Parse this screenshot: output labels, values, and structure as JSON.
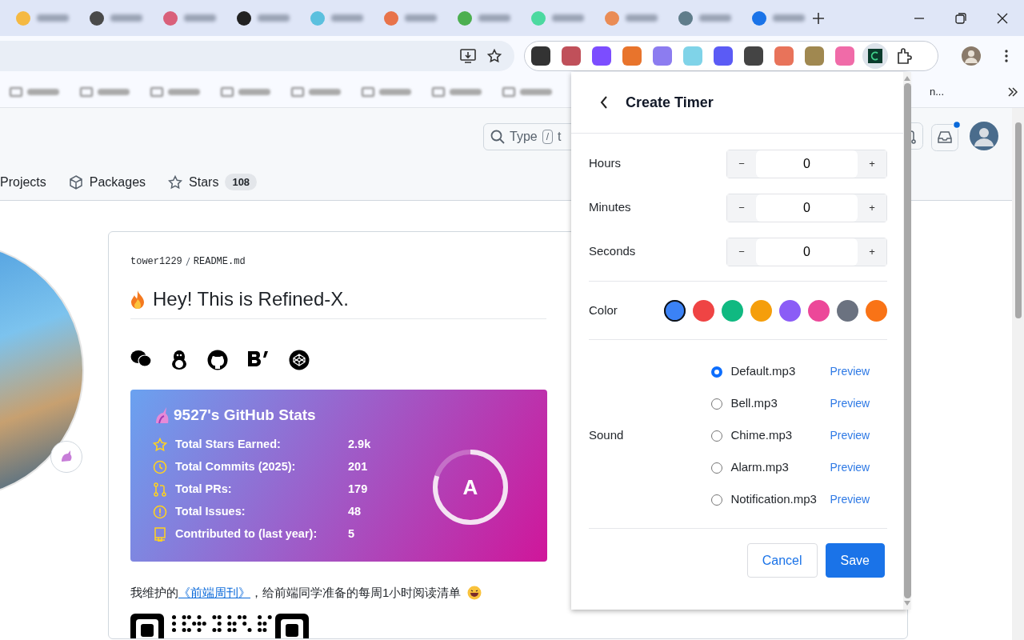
{
  "browser": {
    "tabs": [
      {
        "color": "#f5b942"
      },
      {
        "color": "#4a4a4a"
      },
      {
        "color": "#d9607a"
      },
      {
        "color": "#222222"
      },
      {
        "color": "#5bc0de"
      },
      {
        "color": "#e8734a"
      },
      {
        "color": "#4caf50"
      },
      {
        "color": "#4cd9a0"
      },
      {
        "color": "#ea8c55"
      },
      {
        "color": "#607d8b"
      },
      {
        "color": "#1a73e8"
      }
    ],
    "extensions": [
      {
        "color": "#333333"
      },
      {
        "color": "#c0505a"
      },
      {
        "color": "#7c4dff"
      },
      {
        "color": "#e8742c"
      },
      {
        "color": "#8c7cf0"
      },
      {
        "color": "#7fd3e8"
      },
      {
        "color": "#5b5bf5"
      },
      {
        "color": "#444444"
      },
      {
        "color": "#e8735a"
      },
      {
        "color": "#a08850"
      },
      {
        "color": "#f06ba8"
      }
    ],
    "bookmark_overflow": "n..."
  },
  "github": {
    "search": {
      "start": "Type",
      "shortcut": "/",
      "end": "t"
    },
    "nav": [
      {
        "kind": "projects",
        "label": "Projects"
      },
      {
        "kind": "packages",
        "label": "Packages"
      },
      {
        "kind": "stars",
        "label": "Stars",
        "count": "108"
      }
    ],
    "readme": {
      "owner": "tower1229",
      "file": "README.md",
      "heading": "Hey! This is Refined-X.",
      "stats": {
        "title": "9527's GitHub Stats",
        "grade": "A",
        "level": 0.8,
        "rows": [
          {
            "kind": "star",
            "label": "Total Stars Earned:",
            "value": "2.9k"
          },
          {
            "kind": "commits",
            "label": "Total Commits (2025):",
            "value": "201"
          },
          {
            "kind": "prs",
            "label": "Total PRs:",
            "value": "179"
          },
          {
            "kind": "issues",
            "label": "Total Issues:",
            "value": "48"
          },
          {
            "kind": "contrib",
            "label": "Contributed to (last year):",
            "value": "5"
          }
        ]
      },
      "line": {
        "before": "我维护的",
        "link": "《前端周刊》",
        "after": "，给前端同学准备的每周1小时阅读清单"
      }
    }
  },
  "popup": {
    "title": "Create Timer",
    "fields": [
      {
        "label": "Hours",
        "value": "0",
        "minus": "−",
        "plus": "+"
      },
      {
        "label": "Minutes",
        "value": "0",
        "minus": "−",
        "plus": "+"
      },
      {
        "label": "Seconds",
        "value": "0",
        "minus": "−",
        "plus": "+"
      }
    ],
    "color_label": "Color",
    "colors": [
      {
        "color": "#3b82f6",
        "selected": true
      },
      {
        "color": "#ef4444",
        "selected": false
      },
      {
        "color": "#10b981",
        "selected": false
      },
      {
        "color": "#f59e0b",
        "selected": false
      },
      {
        "color": "#8b5cf6",
        "selected": false
      },
      {
        "color": "#ec4899",
        "selected": false
      },
      {
        "color": "#6b7280",
        "selected": false
      },
      {
        "color": "#f97316",
        "selected": false
      }
    ],
    "sound_label": "Sound",
    "sounds": [
      {
        "name": "Default.mp3",
        "selected": true,
        "action": "Preview"
      },
      {
        "name": "Bell.mp3",
        "selected": false,
        "action": "Preview"
      },
      {
        "name": "Chime.mp3",
        "selected": false,
        "action": "Preview"
      },
      {
        "name": "Alarm.mp3",
        "selected": false,
        "action": "Preview"
      },
      {
        "name": "Notification.mp3",
        "selected": false,
        "action": "Preview"
      }
    ],
    "buttons": [
      {
        "label": "Cancel",
        "kind": "secondary"
      },
      {
        "label": "Save",
        "kind": "primary"
      }
    ]
  }
}
